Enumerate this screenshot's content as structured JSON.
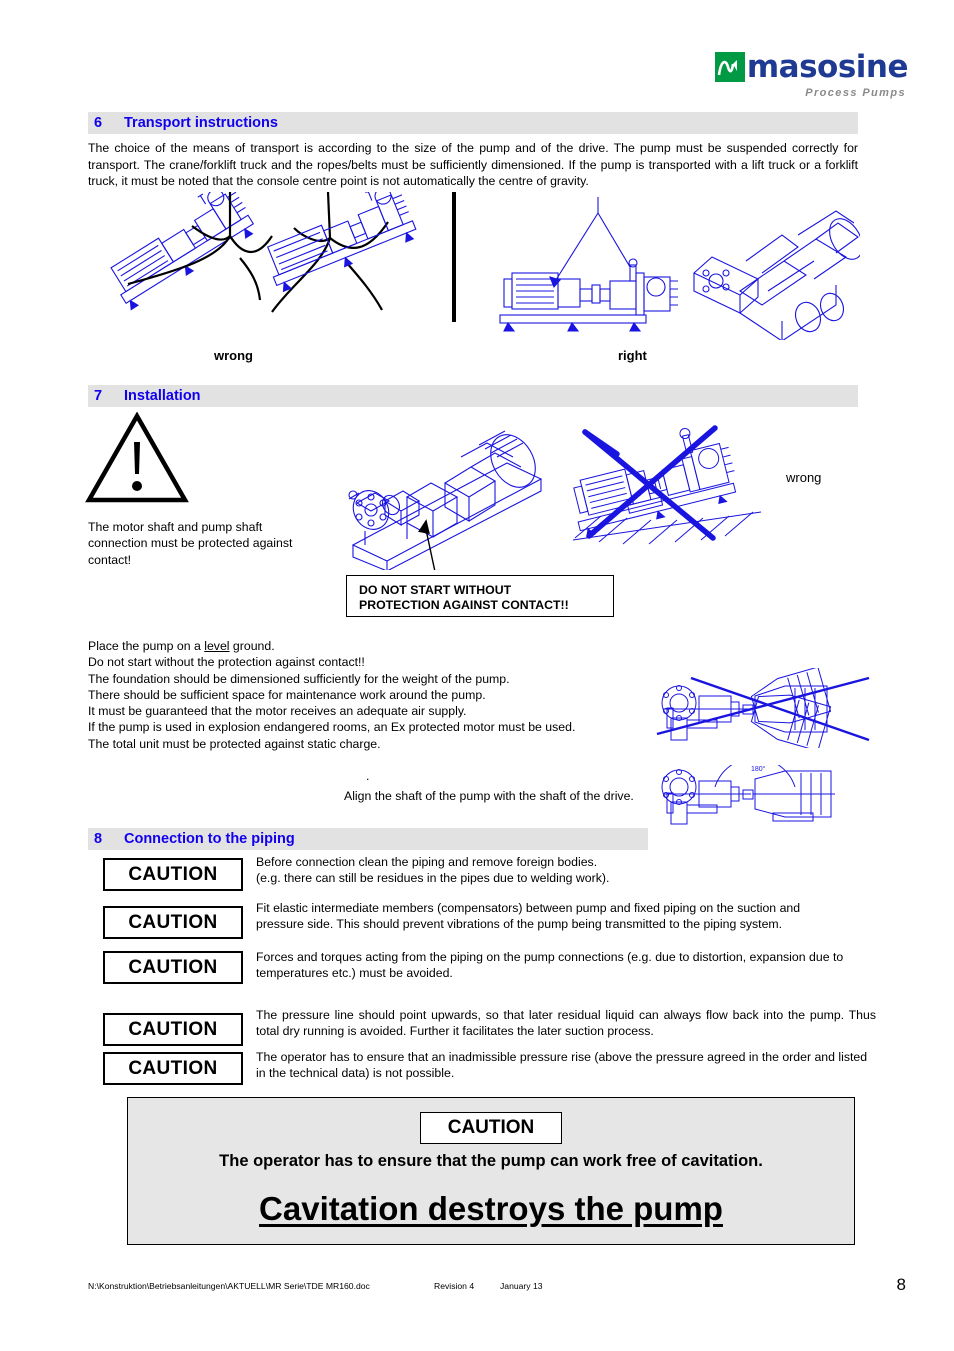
{
  "document": {
    "page_number": "8",
    "footer_path": "N:\\Konstruktion\\Betriebsanleitungen\\AKTUELL\\MR Serie\\TDE MR160.doc",
    "footer_revision": "Revision 4",
    "footer_date": "January 13"
  },
  "logo": {
    "wordmark": "masosine",
    "tagline": "Process Pumps",
    "mark_color": "#009A44",
    "word_color": "#1F3A93",
    "tagline_color": "#8A8A8A"
  },
  "sections": {
    "transport": {
      "number": "6",
      "title": "Transport instructions",
      "body": " The choice of the means of transport is according to the size of the pump and of the drive. The pump must be suspended correctly for transport. The crane/forklift truck and the ropes/belts must be sufficiently dimensioned. If the pump is transported with a lift truck or a forklift truck, it must be noted that the console centre point is not automatically the centre of gravity.",
      "label_wrong": "wrong",
      "label_right": "right"
    },
    "installation": {
      "number": "7",
      "title": "Installation",
      "warning_text": "The motor shaft and pump shaft connection must be protected against contact!",
      "callout_line1": "DO NOT START WITHOUT",
      "callout_line2": "PROTECTION AGAINST CONTACT!!",
      "label_wrong": "wrong",
      "bullets": [
        "Place the pump on a level ground.",
        "Do not start without the protection against contact!!",
        "The foundation should be dimensioned sufficiently for the weight of the pump.",
        "There should be sufficient space for maintenance work around the pump.",
        "It must be guaranteed that the motor receives an adequate air supply.",
        "If the pump is used in explosion endangered rooms, an Ex protected motor must be used.",
        "The total unit must be protected against static charge."
      ],
      "bullet_underlined_word": "level",
      "align_note": "Align the shaft of the pump with the shaft of the drive.",
      "stray_dot": ".",
      "diagram_angle_label": "180°"
    },
    "piping": {
      "number": "8",
      "title": "Connection to the piping",
      "caution_label": "CAUTION",
      "items": [
        {
          "caution": "CAUTION",
          "text": "Before connection clean the piping and remove foreign bodies.\n(e.g. there can still be residues in the pipes due to welding work)."
        },
        {
          "caution": "CAUTION",
          "text": "Fit elastic intermediate members (compensators) between pump and fixed piping on the suction and pressure side. This should prevent vibrations of the pump being transmitted to the piping system."
        },
        {
          "caution": "CAUTION",
          "text": "Forces and torques acting from the piping on the pump connections (e.g. due to distortion, expansion due to temperatures etc.) must be avoided."
        },
        {
          "caution": "CAUTION",
          "text": "The pressure line should point upwards, so that later residual liquid can always flow back into the pump. Thus total dry running is avoided. Further it facilitates the later suction process."
        },
        {
          "caution": "CAUTION",
          "text": "The operator has to ensure that an inadmissible pressure rise (above the pressure agreed in the order and listed in the technical data) is not possible."
        }
      ]
    },
    "cavitation_panel": {
      "caution_label": "CAUTION",
      "line1": "The operator has to ensure that the pump can work free of cavitation.",
      "line2": "Cavitation destroys the pump"
    }
  },
  "colors": {
    "heading_blue": "#1100EE",
    "band_gray": "#E2E2E2",
    "drawing_blue": "#1A14E0",
    "panel_gray": "#E6E6E6"
  }
}
